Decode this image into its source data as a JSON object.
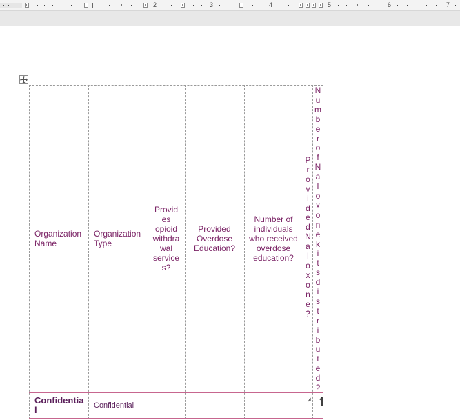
{
  "ruler": {
    "numbers": [
      "2",
      "3",
      "4",
      "5",
      "6",
      "7"
    ]
  },
  "table": {
    "headers": [
      "Organization Name",
      "Organization Type",
      "Provides opioid withdrawal services?",
      "Provided Overdose Education?",
      "Number of individuals who received overdose education?",
      "Provided Naloxone?",
      "Number of Naloxone kits distributed?"
    ],
    "header_lines": {
      "withdrawal": [
        "Provid",
        "es",
        "opioid",
        "withdra",
        "wal",
        "service",
        "s?"
      ],
      "overdose": [
        "Provided",
        "Overdose",
        "Education?"
      ],
      "individuals": [
        "Number of",
        "individuals",
        "who received",
        "overdose",
        "education?"
      ],
      "org_name": [
        "Organization",
        "Name"
      ],
      "org_type": [
        "Organization",
        "Type"
      ]
    },
    "row": {
      "organization_name": "Confidential",
      "organization_name_lines": [
        "Confidentia",
        "l"
      ],
      "organization_type": "Confidential"
    }
  },
  "colors": {
    "header_text": "#7b2466",
    "bold_text": "#5a1f5a",
    "row_border": "#c7668f"
  }
}
